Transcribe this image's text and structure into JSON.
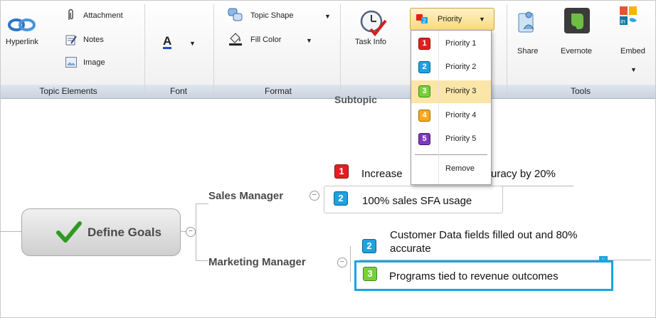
{
  "ribbon": {
    "topic_elements": {
      "hyperlink": "Hyperlink",
      "attachment": "Attachment",
      "notes": "Notes",
      "image": "Image",
      "group_label": "Topic Elements"
    },
    "font": {
      "glyph": "A",
      "group_label": "Font"
    },
    "format": {
      "topic_shape": "Topic Shape",
      "fill_color": "Fill Color",
      "group_label": "Format"
    },
    "task_info": "Task Info",
    "priority_button": "Priority",
    "tools": {
      "share": "Share",
      "evernote": "Evernote",
      "embed": "Embed",
      "group_label": "Tools"
    }
  },
  "priority_menu": {
    "items": [
      {
        "num": "1",
        "label": "Priority 1"
      },
      {
        "num": "2",
        "label": "Priority 2"
      },
      {
        "num": "3",
        "label": "Priority 3"
      },
      {
        "num": "4",
        "label": "Priority 4"
      },
      {
        "num": "5",
        "label": "Priority 5"
      }
    ],
    "remove": "Remove"
  },
  "map": {
    "root": "Define Goals",
    "subtopic_partial": "Subtopic",
    "sales_manager": "Sales Manager",
    "marketing_manager": "Marketing Manager",
    "topics": [
      {
        "priority": "1",
        "text_left": "Increase",
        "text_right": "uracy by 20%"
      },
      {
        "priority": "2",
        "text": "100% sales SFA usage"
      },
      {
        "priority": "2",
        "line1": "Customer Data fields filled out and 80%",
        "line2": "accurate"
      },
      {
        "priority": "3",
        "text": "Programs tied to revenue outcomes"
      }
    ]
  }
}
